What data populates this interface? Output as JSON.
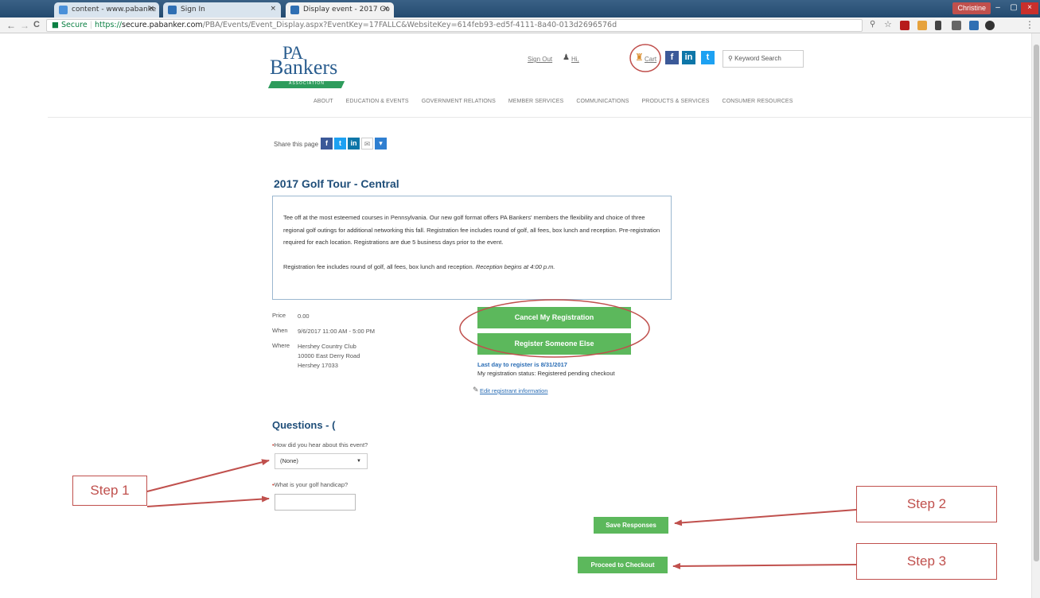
{
  "browser": {
    "tabs": [
      {
        "title": "content - www.pabanke",
        "close": "×"
      },
      {
        "title": "Sign In",
        "close": "×"
      },
      {
        "title": "Display event - 2017 Go",
        "close": "×"
      }
    ],
    "user_chip": "Christine",
    "window_controls": {
      "minimize": "–",
      "maximize": "▢",
      "close": "×"
    },
    "nav": {
      "back": "←",
      "forward": "→",
      "reload": "C"
    },
    "secure_label": "Secure",
    "url_scheme": "https://",
    "url_host": "secure.pabanker.com",
    "url_path": "/PBA/Events/Event_Display.aspx?EventKey=17FALLC&WebsiteKey=614feb93-ed5f-4111-8a40-013d2696576d"
  },
  "header": {
    "logo_pa": "PA",
    "logo_bankers": "Bankers",
    "logo_assoc": "ASSOCIATION",
    "sign_out": "Sign Out",
    "hi": "Hi,",
    "cart": "Cart",
    "keyword_search": "Keyword Search",
    "nav_items": [
      "ABOUT",
      "EDUCATION & EVENTS",
      "GOVERNMENT RELATIONS",
      "MEMBER SERVICES",
      "COMMUNICATIONS",
      "PRODUCTS & SERVICES",
      "CONSUMER RESOURCES"
    ]
  },
  "share": {
    "label": "Share this page"
  },
  "event": {
    "title": "2017 Golf Tour - Central",
    "description_p1": "Tee off at the most esteemed courses in Pennsylvania. Our new golf format offers PA Bankers' members the flexibility and choice of three regional golf outings for additional networking this fall. Registration fee includes round of golf, all fees, box lunch and reception. Pre-registration required for each location. Registrations are due 5 business days prior to the event.",
    "description_p2": "Registration fee includes round of golf, all fees, box lunch and reception.",
    "description_p2_em": "Reception begins at 4:00 p.m.",
    "price_label": "Price",
    "price_value": "0.00",
    "when_label": "When",
    "when_value": "9/6/2017 11:00 AM - 5:00 PM",
    "where_label": "Where",
    "where_line1": "Hershey Country Club",
    "where_line2": "10000 East Derry Road",
    "where_line3": "Hershey 17033"
  },
  "registration": {
    "cancel_button": "Cancel My Registration",
    "register_else_button": "Register Someone Else",
    "last_day": "Last day to register is 8/31/2017",
    "status": "My registration status: Registered pending checkout",
    "edit_link": "Edit registrant information"
  },
  "questions": {
    "heading": "Questions - (",
    "required_mark": "•",
    "q1": "How did you hear about this event?",
    "q1_value": "(None)",
    "q2": "What is your golf handicap?",
    "q2_value": ""
  },
  "actions": {
    "save": "Save Responses",
    "checkout": "Proceed to Checkout"
  },
  "annotations": {
    "step1": "Step 1",
    "step2": "Step 2",
    "step3": "Step 3",
    "color": "#c0504d"
  },
  "colors": {
    "brand_blue": "#1f4e79",
    "button_green": "#5cb85c",
    "link_blue": "#2a6db5"
  }
}
